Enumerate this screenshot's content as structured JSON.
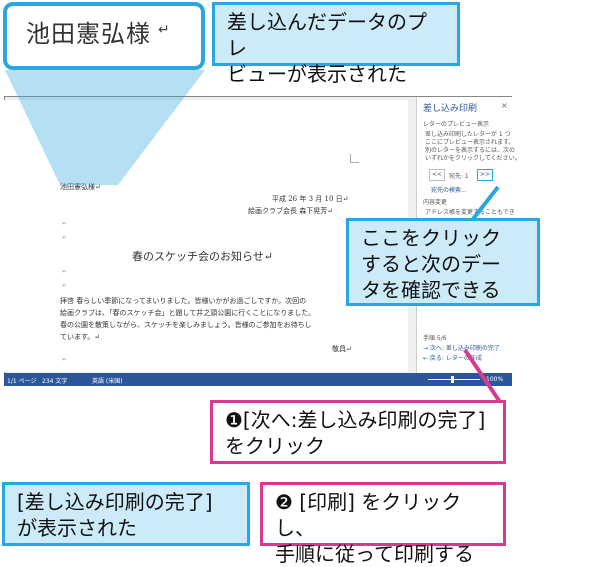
{
  "zoom": {
    "name": "池田憲弘様",
    "mark": "↵"
  },
  "callouts": {
    "preview": [
      "差し込んだデータのプレ",
      "ビューが表示された"
    ],
    "next": [
      "ここをクリック",
      "すると次のデー",
      "タを確認できる"
    ],
    "step1": [
      "❶[次へ:差し込み印刷の完了]",
      "をクリック"
    ],
    "complete": [
      "[差し込み印刷の完了]",
      "が表示された"
    ],
    "step2": [
      "❷ [印刷] をクリックし、",
      "手順に従って印刷する"
    ]
  },
  "document": {
    "recipient": "池田憲弘様↵",
    "date": "平成 26 年 3 月 10 日↵",
    "sender": "絵画クラブ会長 森下晃芳↵",
    "title": "春のスケッチ会のお知らせ↵",
    "body": [
      "拝啓 春らしい季節になってまいりました。皆様いかがお過ごしですか。次回の",
      "絵画クラブは、「春のスケッチ会」と題して井之頭公園に行くことになりました。",
      "春の公園を散策しながら、スケッチを楽しみましょう。皆様のご参加をお待ちし",
      "ています。↵"
    ],
    "closing": "敬具↵"
  },
  "pane": {
    "title": "差し込み印刷",
    "close": "×",
    "section": "レターのプレビュー表示",
    "desc": [
      "差し込み印刷したレターが 1 つ",
      "ここにプレビュー表示されます。",
      "別のレターを表示するには、次の",
      "いずれかをクリックしてください。"
    ],
    "recipient_label": "宛先: 1",
    "prev_btn": "<<",
    "next_btn": ">>",
    "find": "宛先の検索...",
    "section2": "内容変更",
    "edit_recipient": "アドレス帳を変更することもでき",
    "step": "手順 5/6",
    "next_link": "→ 次へ: 差し込み印刷の完了",
    "back_link": "← 戻る: レターの作成"
  },
  "status": {
    "page": "1/1 ページ",
    "words": "234 文字",
    "lang": "英語 (米国)",
    "zoom": "100%"
  },
  "colors": {
    "blue": "#2aa6e0",
    "pink": "#d93a8f",
    "word_blue": "#2b579a"
  }
}
